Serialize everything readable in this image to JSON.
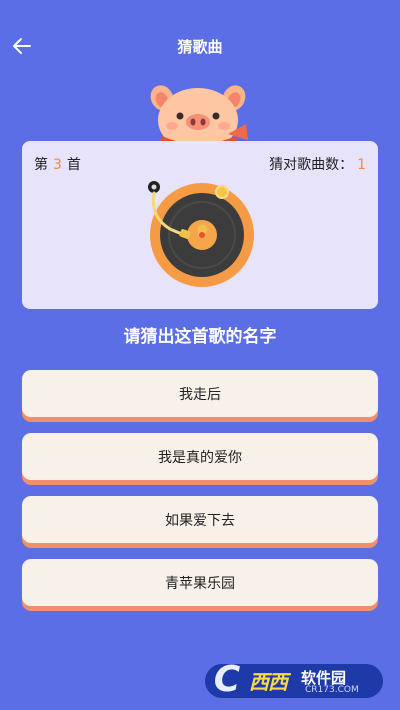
{
  "header": {
    "title": "猜歌曲",
    "back_icon": "arrow-left-icon"
  },
  "game": {
    "round_prefix": "第",
    "round_number": "3",
    "round_suffix": "首",
    "correct_label": "猜对歌曲数：",
    "correct_count": "1",
    "prompt": "请猜出这首歌的名字"
  },
  "options": [
    "我走后",
    "我是真的爱你",
    "如果爱下去",
    "青苹果乐园"
  ],
  "watermark": {
    "brand": "西西",
    "name": "软件园",
    "domain": "CR173.COM"
  },
  "colors": {
    "background": "#5b6ee6",
    "card": "#e7e3fb",
    "accent_number": "#f08a48",
    "option_bg": "#f7f1ea",
    "option_shadow": "#ef8f6c"
  }
}
